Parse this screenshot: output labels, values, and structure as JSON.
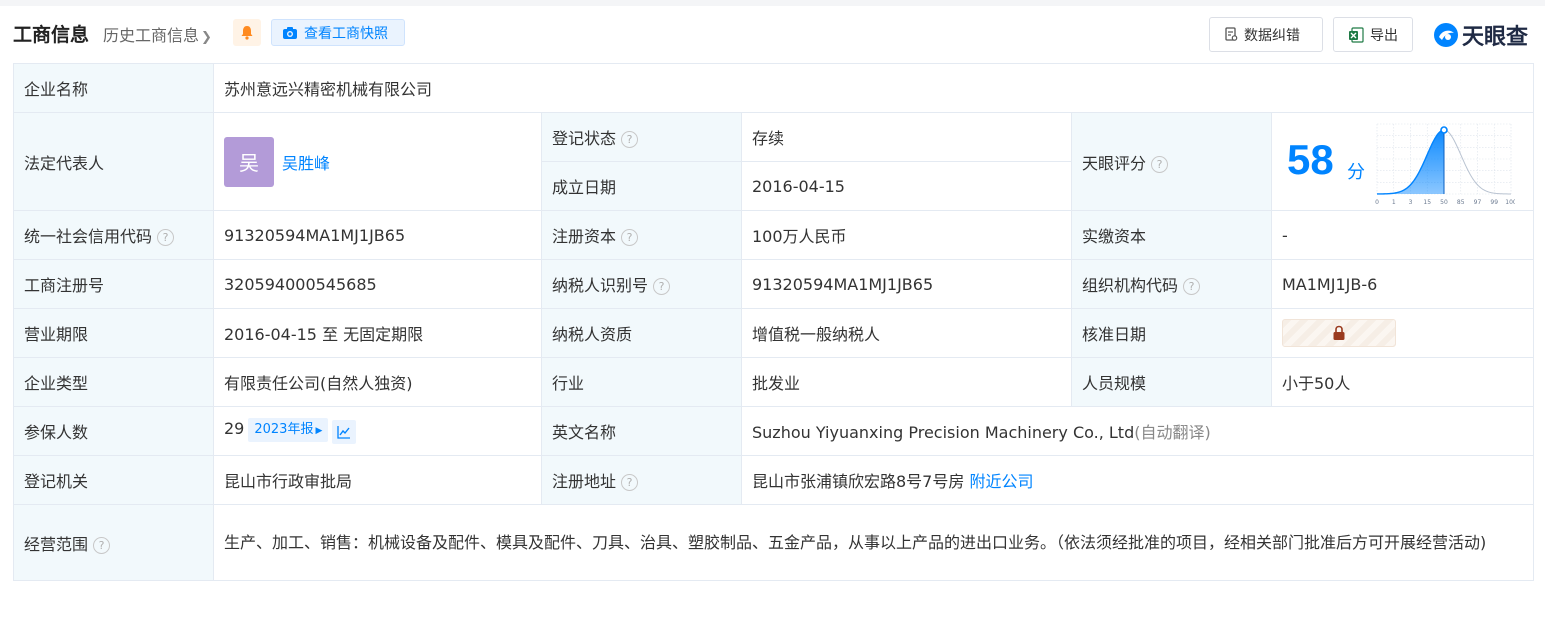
{
  "header": {
    "title": "工商信息",
    "history": "历史工商信息",
    "snapshot_label": "查看工商快照",
    "correct_label": "数据纠错",
    "export_label": "导出",
    "logo_text": "天眼查"
  },
  "rows": {
    "company_name": {
      "label": "企业名称",
      "value": "苏州意远兴精密机械有限公司"
    },
    "legal_rep": {
      "label": "法定代表人",
      "avatar": "吴",
      "name": "吴胜峰"
    },
    "reg_status": {
      "label": "登记状态",
      "value": "存续"
    },
    "found_date": {
      "label": "成立日期",
      "value": "2016-04-15"
    },
    "tianyan_score": {
      "label": "天眼评分",
      "score": "58",
      "unit": "分"
    },
    "credit_code": {
      "label": "统一社会信用代码",
      "value": "91320594MA1MJ1JB65"
    },
    "reg_capital": {
      "label": "注册资本",
      "value": "100万人民币"
    },
    "paid_capital": {
      "label": "实缴资本",
      "value": "-"
    },
    "biz_reg_no": {
      "label": "工商注册号",
      "value": "320594000545685"
    },
    "taxpayer_id": {
      "label": "纳税人识别号",
      "value": "91320594MA1MJ1JB65"
    },
    "org_code": {
      "label": "组织机构代码",
      "value": "MA1MJ1JB-6"
    },
    "biz_term": {
      "label": "营业期限",
      "value": "2016-04-15 至 无固定期限"
    },
    "taxpayer_qual": {
      "label": "纳税人资质",
      "value": "增值税一般纳税人"
    },
    "approve_date": {
      "label": "核准日期"
    },
    "company_type": {
      "label": "企业类型",
      "value": "有限责任公司(自然人独资)"
    },
    "industry": {
      "label": "行业",
      "value": "批发业"
    },
    "staff_size": {
      "label": "人员规模",
      "value": "小于50人"
    },
    "insured": {
      "label": "参保人数",
      "value": "29",
      "report_tag": "2023年报"
    },
    "english_name": {
      "label": "英文名称",
      "value": "Suzhou Yiyuanxing Precision Machinery Co., Ltd",
      "note": "(自动翻译)"
    },
    "reg_authority": {
      "label": "登记机关",
      "value": "昆山市行政审批局"
    },
    "reg_address": {
      "label": "注册地址",
      "value": "昆山市张浦镇欣宏路8号7号房",
      "nearby": "附近公司"
    },
    "biz_scope": {
      "label": "经营范围",
      "value": "生产、加工、销售：机械设备及配件、模具及配件、刀具、治具、塑胶制品、五金产品，从事以上产品的进出口业务。（依法须经批准的项目，经相关部门批准后方可开展经营活动)"
    }
  },
  "chart_data": {
    "type": "area",
    "x_ticks": [
      "0",
      "1",
      "3",
      "15",
      "50",
      "85",
      "97",
      "99",
      "100"
    ],
    "marker_tick": "50",
    "color": "#0084ff"
  },
  "colors": {
    "accent": "#0084ff",
    "status_green": "#22a653",
    "label_bg": "#f2f9fc",
    "avatar_bg": "#b39bd8"
  },
  "icons": {
    "bell": "bell-icon",
    "camera": "camera-icon",
    "correct": "edit-doc-icon",
    "export": "excel-icon",
    "help": "question-icon",
    "lock": "lock-icon",
    "trend": "trend-icon"
  }
}
